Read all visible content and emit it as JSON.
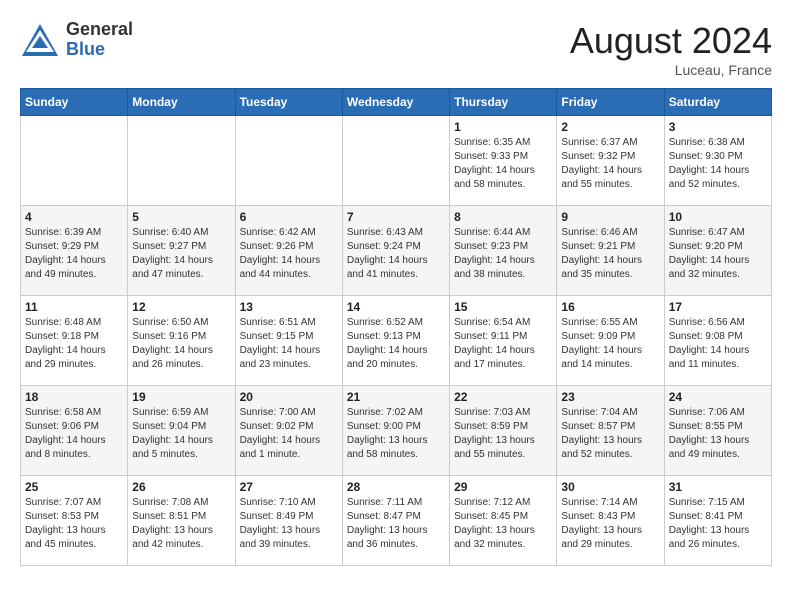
{
  "logo": {
    "general": "General",
    "blue": "Blue"
  },
  "title": "August 2024",
  "location": "Luceau, France",
  "days_of_week": [
    "Sunday",
    "Monday",
    "Tuesday",
    "Wednesday",
    "Thursday",
    "Friday",
    "Saturday"
  ],
  "weeks": [
    [
      {
        "day": "",
        "info": ""
      },
      {
        "day": "",
        "info": ""
      },
      {
        "day": "",
        "info": ""
      },
      {
        "day": "",
        "info": ""
      },
      {
        "day": "1",
        "info": "Sunrise: 6:35 AM\nSunset: 9:33 PM\nDaylight: 14 hours and 58 minutes."
      },
      {
        "day": "2",
        "info": "Sunrise: 6:37 AM\nSunset: 9:32 PM\nDaylight: 14 hours and 55 minutes."
      },
      {
        "day": "3",
        "info": "Sunrise: 6:38 AM\nSunset: 9:30 PM\nDaylight: 14 hours and 52 minutes."
      }
    ],
    [
      {
        "day": "4",
        "info": "Sunrise: 6:39 AM\nSunset: 9:29 PM\nDaylight: 14 hours and 49 minutes."
      },
      {
        "day": "5",
        "info": "Sunrise: 6:40 AM\nSunset: 9:27 PM\nDaylight: 14 hours and 47 minutes."
      },
      {
        "day": "6",
        "info": "Sunrise: 6:42 AM\nSunset: 9:26 PM\nDaylight: 14 hours and 44 minutes."
      },
      {
        "day": "7",
        "info": "Sunrise: 6:43 AM\nSunset: 9:24 PM\nDaylight: 14 hours and 41 minutes."
      },
      {
        "day": "8",
        "info": "Sunrise: 6:44 AM\nSunset: 9:23 PM\nDaylight: 14 hours and 38 minutes."
      },
      {
        "day": "9",
        "info": "Sunrise: 6:46 AM\nSunset: 9:21 PM\nDaylight: 14 hours and 35 minutes."
      },
      {
        "day": "10",
        "info": "Sunrise: 6:47 AM\nSunset: 9:20 PM\nDaylight: 14 hours and 32 minutes."
      }
    ],
    [
      {
        "day": "11",
        "info": "Sunrise: 6:48 AM\nSunset: 9:18 PM\nDaylight: 14 hours and 29 minutes."
      },
      {
        "day": "12",
        "info": "Sunrise: 6:50 AM\nSunset: 9:16 PM\nDaylight: 14 hours and 26 minutes."
      },
      {
        "day": "13",
        "info": "Sunrise: 6:51 AM\nSunset: 9:15 PM\nDaylight: 14 hours and 23 minutes."
      },
      {
        "day": "14",
        "info": "Sunrise: 6:52 AM\nSunset: 9:13 PM\nDaylight: 14 hours and 20 minutes."
      },
      {
        "day": "15",
        "info": "Sunrise: 6:54 AM\nSunset: 9:11 PM\nDaylight: 14 hours and 17 minutes."
      },
      {
        "day": "16",
        "info": "Sunrise: 6:55 AM\nSunset: 9:09 PM\nDaylight: 14 hours and 14 minutes."
      },
      {
        "day": "17",
        "info": "Sunrise: 6:56 AM\nSunset: 9:08 PM\nDaylight: 14 hours and 11 minutes."
      }
    ],
    [
      {
        "day": "18",
        "info": "Sunrise: 6:58 AM\nSunset: 9:06 PM\nDaylight: 14 hours and 8 minutes."
      },
      {
        "day": "19",
        "info": "Sunrise: 6:59 AM\nSunset: 9:04 PM\nDaylight: 14 hours and 5 minutes."
      },
      {
        "day": "20",
        "info": "Sunrise: 7:00 AM\nSunset: 9:02 PM\nDaylight: 14 hours and 1 minute."
      },
      {
        "day": "21",
        "info": "Sunrise: 7:02 AM\nSunset: 9:00 PM\nDaylight: 13 hours and 58 minutes."
      },
      {
        "day": "22",
        "info": "Sunrise: 7:03 AM\nSunset: 8:59 PM\nDaylight: 13 hours and 55 minutes."
      },
      {
        "day": "23",
        "info": "Sunrise: 7:04 AM\nSunset: 8:57 PM\nDaylight: 13 hours and 52 minutes."
      },
      {
        "day": "24",
        "info": "Sunrise: 7:06 AM\nSunset: 8:55 PM\nDaylight: 13 hours and 49 minutes."
      }
    ],
    [
      {
        "day": "25",
        "info": "Sunrise: 7:07 AM\nSunset: 8:53 PM\nDaylight: 13 hours and 45 minutes."
      },
      {
        "day": "26",
        "info": "Sunrise: 7:08 AM\nSunset: 8:51 PM\nDaylight: 13 hours and 42 minutes."
      },
      {
        "day": "27",
        "info": "Sunrise: 7:10 AM\nSunset: 8:49 PM\nDaylight: 13 hours and 39 minutes."
      },
      {
        "day": "28",
        "info": "Sunrise: 7:11 AM\nSunset: 8:47 PM\nDaylight: 13 hours and 36 minutes."
      },
      {
        "day": "29",
        "info": "Sunrise: 7:12 AM\nSunset: 8:45 PM\nDaylight: 13 hours and 32 minutes."
      },
      {
        "day": "30",
        "info": "Sunrise: 7:14 AM\nSunset: 8:43 PM\nDaylight: 13 hours and 29 minutes."
      },
      {
        "day": "31",
        "info": "Sunrise: 7:15 AM\nSunset: 8:41 PM\nDaylight: 13 hours and 26 minutes."
      }
    ]
  ]
}
